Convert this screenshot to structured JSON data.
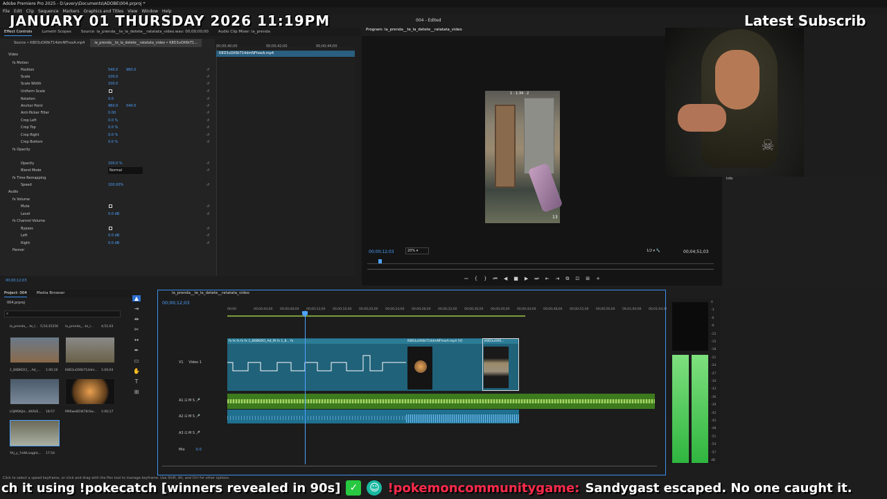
{
  "app": {
    "title": "Adobe Premiere Pro 2025 - D:\\avery\\Documents\\ADOBE\\004.prproj *",
    "sequence_title": "004 - Edited",
    "menu": [
      "File",
      "Edit",
      "Clip",
      "Sequence",
      "Markers",
      "Graphics and Titles",
      "View",
      "Window",
      "Help"
    ]
  },
  "overlay": {
    "date": "JANUARY 01 THURSDAY 2026 11:19PM",
    "latest": "Latest Subscrib"
  },
  "panel_tabs": [
    "Effect Controls",
    "Lumetri Scopes",
    "Source: la_prenda__te_la_detete__ratatata_video.wav: 00;00;00;00",
    "Audio Clip Mixer: la_prenda"
  ],
  "source_bar": {
    "left": "Source • K8D3uOX6kT14dmNFhoxA.mp4",
    "clip": "la_prenda__te_la_detete__ratatata_video • K8D3uOX6kT1..."
  },
  "effect_controls": {
    "ruler": [
      "00;00;40;00",
      "00;00;42;00",
      "00;00;44;00"
    ],
    "clip_bar": "K8D3uOX6kT14dmNFhoxA.mp4",
    "time": "00;00;12;03",
    "rows": [
      {
        "name": "Video",
        "indent": 0
      },
      {
        "name": "fx  Motion",
        "indent": 1
      },
      {
        "name": "Position",
        "indent": 3,
        "v1": "540.0",
        "v2": "960.0"
      },
      {
        "name": "Scale",
        "indent": 3,
        "v1": "100.0"
      },
      {
        "name": "Scale Width",
        "indent": 3,
        "v1": "100.0"
      },
      {
        "name": "Uniform Scale",
        "indent": 3,
        "checkbox": true
      },
      {
        "name": "Rotation",
        "indent": 3,
        "v1": "0.0"
      },
      {
        "name": "Anchor Point",
        "indent": 3,
        "v1": "960.0",
        "v2": "540.0"
      },
      {
        "name": "Anti-flicker Filter",
        "indent": 3,
        "v1": "0.00"
      },
      {
        "name": "Crop Left",
        "indent": 3,
        "v1": "0.0 %"
      },
      {
        "name": "Crop Top",
        "indent": 3,
        "v1": "0.0 %"
      },
      {
        "name": "Crop Right",
        "indent": 3,
        "v1": "0.0 %"
      },
      {
        "name": "Crop Bottom",
        "indent": 3,
        "v1": "0.0 %"
      },
      {
        "name": "fx  Opacity",
        "indent": 1
      },
      {
        "name": "",
        "indent": 3
      },
      {
        "name": "Opacity",
        "indent": 3,
        "v1": "100.0 %"
      },
      {
        "name": "Blend Mode",
        "indent": 3,
        "v1": "Normal"
      },
      {
        "name": "fx  Time Remapping",
        "indent": 1
      },
      {
        "name": "Speed",
        "indent": 3,
        "v1": "100.00%"
      },
      {
        "name": "Audio",
        "indent": 0
      },
      {
        "name": "fx  Volume",
        "indent": 1
      },
      {
        "name": "Mute",
        "indent": 3,
        "checkbox": true
      },
      {
        "name": "Level",
        "indent": 3,
        "v1": "0.0 dB"
      },
      {
        "name": "fx  Channel Volume",
        "indent": 1
      },
      {
        "name": "Bypass",
        "indent": 3,
        "checkbox": true
      },
      {
        "name": "Left",
        "indent": 3,
        "v1": "0.0 dB"
      },
      {
        "name": "Right",
        "indent": 3,
        "v1": "0.0 dB"
      },
      {
        "name": "Panner",
        "indent": 1
      }
    ]
  },
  "program": {
    "tab": "Program: la_prenda__te_la_detete__ratatata_video",
    "time": "00;00;12;03",
    "zoom": "20%",
    "resolution": "1/2",
    "duration": "00;04;51;03",
    "score": "1 · 1:34 · 2",
    "ammo": "13",
    "transport": [
      "⎓",
      "{",
      "}",
      "⏮",
      "◀",
      "■",
      "▶",
      "⏭",
      "⇤",
      "⇥",
      "⧉",
      "⊡",
      "⊞",
      "+"
    ]
  },
  "info": {
    "label": "Info"
  },
  "project": {
    "tabs": [
      "Project: 004",
      "Media Browser"
    ],
    "file": "004.prproj",
    "items": [
      {
        "name": "la_prenda_...te_l...",
        "dur": "5;54;35256"
      },
      {
        "name": "la_prenda_...te_l...",
        "dur": "4;51;03"
      },
      {
        "name": "1_B6BKDCI_...Ad_...",
        "dur": "1:00;16"
      },
      {
        "name": "K8D3uOX6kT14dm...",
        "dur": "1:00;04"
      },
      {
        "name": "LOjMSKjte...4KAVE...",
        "dur": "18:57"
      },
      {
        "name": "M90weBOiK78rSw...",
        "dur": "1:00;17"
      },
      {
        "name": "YAj_y_7oWLivqghL...",
        "dur": "17:54"
      }
    ]
  },
  "timeline": {
    "tab": "la_prenda__te_la_detete__ratatata_video",
    "time": "00;00;12;03",
    "ruler": [
      "00;00",
      "00;00;04;00",
      "00;00;08;00",
      "00;00;12;00",
      "00;00;16;00",
      "00;00;20;00",
      "00;00;24;00",
      "00;00;28;00",
      "00;00;32;00",
      "00;00;36;00",
      "00;00;40;00",
      "00;00;44;00",
      "00;00;48;00",
      "00;00;52;00",
      "00;00;56;00",
      "00;01;00;00",
      "00;01;04;00"
    ],
    "tracks": {
      "v1": "V1",
      "video1": "Video 1",
      "a1": "A1",
      "a2": "A2",
      "a3": "A3",
      "mix": "Mix",
      "mix_val": "0.0"
    },
    "clips": {
      "v1a": "fx   fx   fx   fx   fx   1_B6BKDCI_Ad_f6   fx   1_8...   fx",
      "v1b": "K8D3uOX6kT14dmNFhoxA.mp4 [V]",
      "v1c": "K8D3uOX6..."
    }
  },
  "meter": {
    "scale": [
      "0",
      "-3",
      "-6",
      "-9",
      "-12",
      "-15",
      "-18",
      "-21",
      "-24",
      "-27",
      "-30",
      "-33",
      "-36",
      "-39",
      "-42",
      "-45",
      "-48",
      "-51",
      "-54",
      "-57",
      "dB"
    ]
  },
  "status": "Click to select a speed keyframe, or click and drag with the Pen tool to manage keyframe. Use Shift, Alt, and Ctrl for other options.",
  "ticker": {
    "part1": "ch it using !pokecatch [winners revealed in 90s]",
    "part2": "!pokemoncommunitygame:",
    "part3": "Sandygast escaped. No one caught it."
  }
}
